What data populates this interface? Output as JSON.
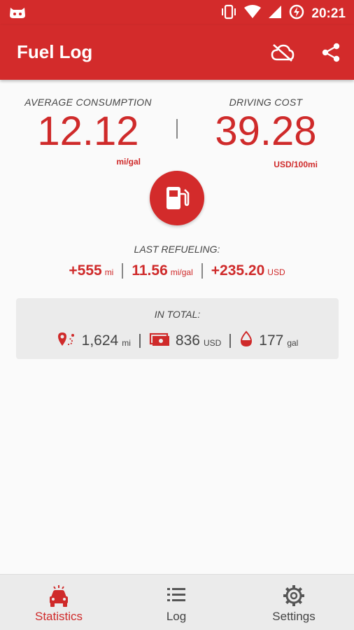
{
  "status_bar": {
    "time": "20:21"
  },
  "app_bar": {
    "title": "Fuel Log"
  },
  "summary": {
    "consumption": {
      "label": "AVERAGE CONSUMPTION",
      "value": "12.12",
      "unit": "mi/gal"
    },
    "cost": {
      "label": "DRIVING COST",
      "value": "39.28",
      "unit": "USD/100mi"
    }
  },
  "last_refueling": {
    "label": "LAST REFUELING:",
    "distance": {
      "value": "+555",
      "unit": "mi"
    },
    "consumption": {
      "value": "11.56",
      "unit": "mi/gal"
    },
    "cost": {
      "value": "+235.20",
      "unit": "USD"
    }
  },
  "in_total": {
    "label": "IN TOTAL:",
    "distance": {
      "value": "1,624",
      "unit": "mi"
    },
    "money": {
      "value": "836",
      "unit": "USD"
    },
    "fuel": {
      "value": "177",
      "unit": "gal"
    }
  },
  "bottom_nav": {
    "items": [
      {
        "label": "Statistics",
        "icon": "car-icon",
        "active": true
      },
      {
        "label": "Log",
        "icon": "list-icon",
        "active": false
      },
      {
        "label": "Settings",
        "icon": "gear-icon",
        "active": false
      }
    ]
  },
  "colors": {
    "primary": "#d32b2b",
    "text": "#444444",
    "card": "#ebebeb"
  }
}
